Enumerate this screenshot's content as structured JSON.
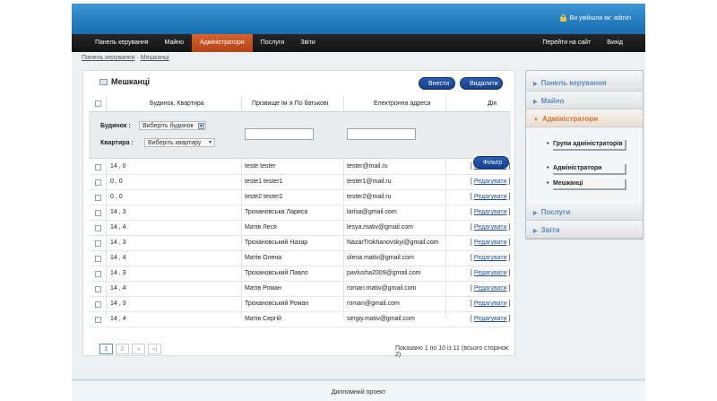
{
  "header": {
    "login_text": "Ви увійшли як: admin"
  },
  "nav": {
    "left": [
      "Панель керування",
      "Майно",
      "Адміністратори",
      "Послуги",
      "Звіти"
    ],
    "active": "Адміністратори",
    "right": [
      "Перейти на сайт",
      "Вихід"
    ]
  },
  "breadcrumb": {
    "home": "Панель керування",
    "separator": "·",
    "current": "Мешканці"
  },
  "panel": {
    "title": "Мешканці",
    "add_label": "Внести",
    "delete_label": "Видалити",
    "filter_label": "Фільтр"
  },
  "table": {
    "columns": [
      "Будинок, Квартира",
      "Прізвище Ім`я По батькові",
      "Електронна адреса",
      "Дія"
    ],
    "filter": {
      "building_label": "Будинок :",
      "building_value": "Виберіть будинок",
      "apartment_label": "Квартира :",
      "apartment_value": "Виберіть квартиру"
    },
    "edit_label": "Редагувати",
    "rows": [
      {
        "addr": "14 , 0",
        "name": "teste tester",
        "email": "tester@mail.ru"
      },
      {
        "addr": "0 , 0",
        "name": "teste1 tester1",
        "email": "tester1@mail.ru"
      },
      {
        "addr": "0 , 0",
        "name": "teste2 tester2",
        "email": "tester2@mail.ru"
      },
      {
        "addr": "14 , 3",
        "name": "Трохановська Лариса",
        "email": "larisa@gmail.com"
      },
      {
        "addr": "14 , 4",
        "name": "Матів Леся",
        "email": "lesya.mativ@gmail.com"
      },
      {
        "addr": "14 , 3",
        "name": "Трохановський Назар",
        "email": "NazarTrokhanovskyi@gmail.com"
      },
      {
        "addr": "14 , 4",
        "name": "Матів Олена",
        "email": "olena.mativ@gmail.com"
      },
      {
        "addr": "14 , 3",
        "name": "Трохановський Павло",
        "email": "pavlusha2009@gmail.com"
      },
      {
        "addr": "14 , 4",
        "name": "Матів Роман",
        "email": "roman.mativ@gmail.com"
      },
      {
        "addr": "14 , 3",
        "name": "Трохановський Роман",
        "email": "roman@gmail.com"
      },
      {
        "addr": "14 , 4",
        "name": "Матів Сергій",
        "email": "sergiy.mativ@gmail.com"
      }
    ]
  },
  "pagination": {
    "pages": [
      "1",
      "2",
      "»",
      "»|"
    ],
    "info": "Показано 1 по 10 із 11 (всього сторінок: 2)"
  },
  "side_menu": {
    "items": [
      "Панель керування",
      "Майно",
      "Адміністратори",
      "Послуги",
      "Звіти"
    ],
    "active": "Адміністратори",
    "sub_items": [
      "Групи адміністраторів",
      "Адміністратори",
      "Мешканці"
    ]
  },
  "footer": {
    "text": "Дипломний проект"
  },
  "colors": {
    "header_blue": "#2a82c2",
    "nav_active": "#c9501f",
    "button_blue": "#1f4c9c",
    "link_blue": "#1f4fa8",
    "side_active": "#d87433"
  }
}
